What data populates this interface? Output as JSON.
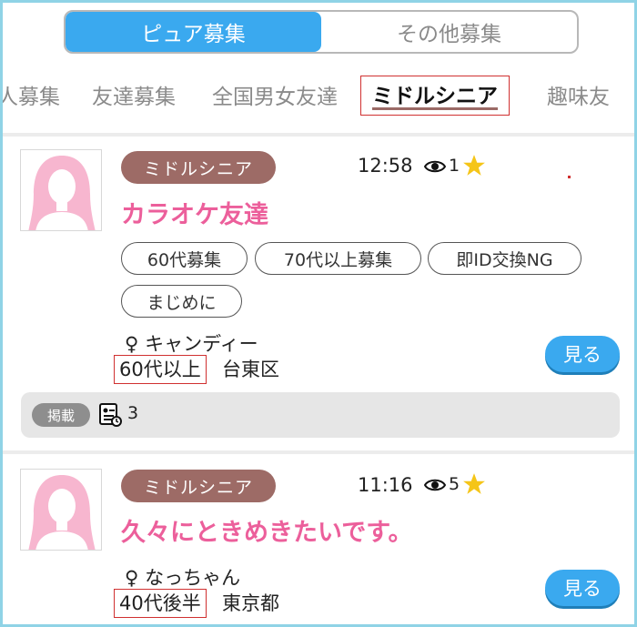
{
  "segment": {
    "active_label": "ピュア募集",
    "inactive_label": "その他募集"
  },
  "tabs": [
    "人募集",
    "友達募集",
    "全国男女友達",
    "ミドルシニア",
    "趣味友"
  ],
  "active_tab": "ミドルシニア",
  "colors": {
    "accent_blue": "#3aa9ef",
    "badge_brown": "#9d6b66",
    "title_pink": "#ec5f9b",
    "star": "#f5c518"
  },
  "posts": [
    {
      "category": "ミドルシニア",
      "time": "12:58",
      "views": "1",
      "title": "カラオケ友達",
      "tags": [
        "60代募集",
        "70代以上募集",
        "即ID交換NG",
        "まじめに"
      ],
      "gender_symbol": "♀",
      "name": "キャンディー",
      "age": "60代以上",
      "area": "台東区",
      "see_label": "見る",
      "post_label": "掲載",
      "post_count": "3"
    },
    {
      "category": "ミドルシニア",
      "time": "11:16",
      "views": "5",
      "title": "久々にときめきたいです。",
      "tags": [],
      "gender_symbol": "♀",
      "name": "なっちゃん",
      "age": "40代後半",
      "area": "東京都",
      "see_label": "見る"
    }
  ]
}
